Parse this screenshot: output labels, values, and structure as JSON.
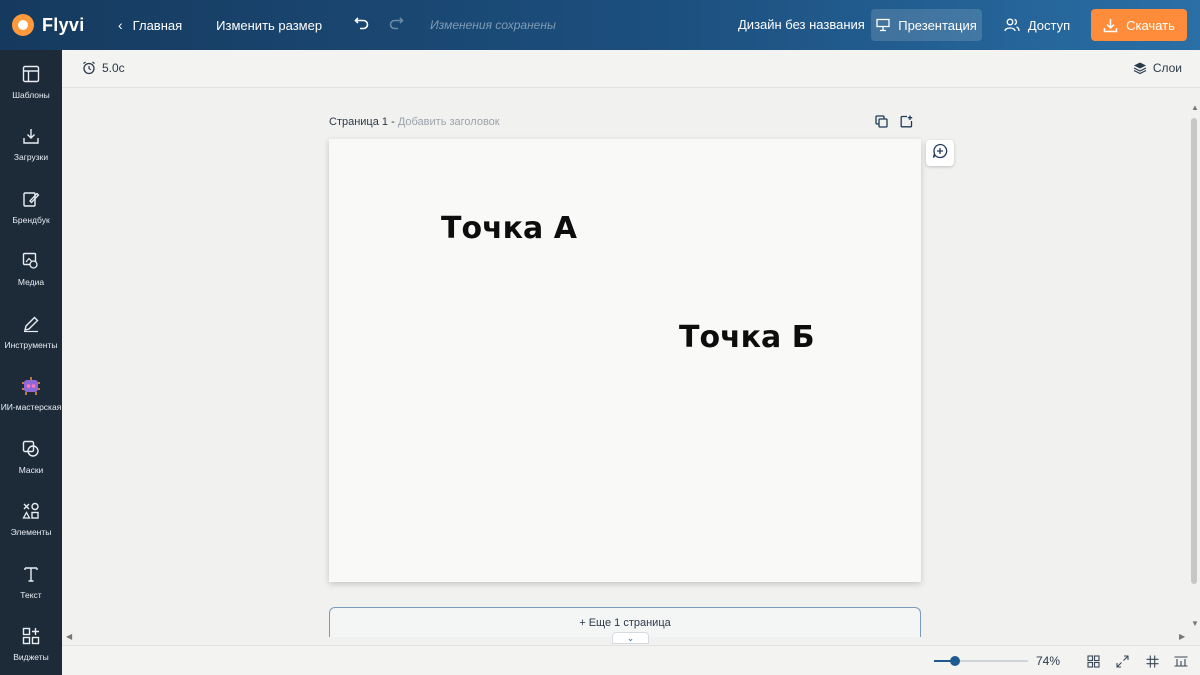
{
  "header": {
    "logo": "Flyvi",
    "home": "Главная",
    "resize": "Изменить размер",
    "saved_status": "Изменения сохранены",
    "design_name": "Дизайн без названия",
    "presentation": "Презентация",
    "access": "Доступ",
    "download": "Скачать"
  },
  "sidebar": {
    "items": [
      {
        "label": "Шаблоны",
        "icon": "templates-icon"
      },
      {
        "label": "Загрузки",
        "icon": "upload-icon"
      },
      {
        "label": "Брендбук",
        "icon": "brandbook-icon"
      },
      {
        "label": "Медиа",
        "icon": "media-icon"
      },
      {
        "label": "Инструменты",
        "icon": "pencil-icon"
      },
      {
        "label": "ИИ-мастерская",
        "icon": "ai-icon"
      },
      {
        "label": "Маски",
        "icon": "masks-icon"
      },
      {
        "label": "Элементы",
        "icon": "elements-icon"
      },
      {
        "label": "Текст",
        "icon": "text-icon"
      },
      {
        "label": "Виджеты",
        "icon": "widgets-icon"
      }
    ]
  },
  "toolbar": {
    "duration": "5.0с",
    "layers": "Слои"
  },
  "page": {
    "title": "Страница 1 -",
    "add_title": "Добавить заголовок",
    "text_a": "Точка А",
    "text_b": "Точка Б",
    "add_page": "+ Еще 1 страница"
  },
  "zoom": {
    "value": "74%",
    "level": 0.22
  },
  "colors": {
    "accent": "#ff8c3a",
    "brand": "#1c4f7e",
    "sidebar": "#1d2a38"
  }
}
